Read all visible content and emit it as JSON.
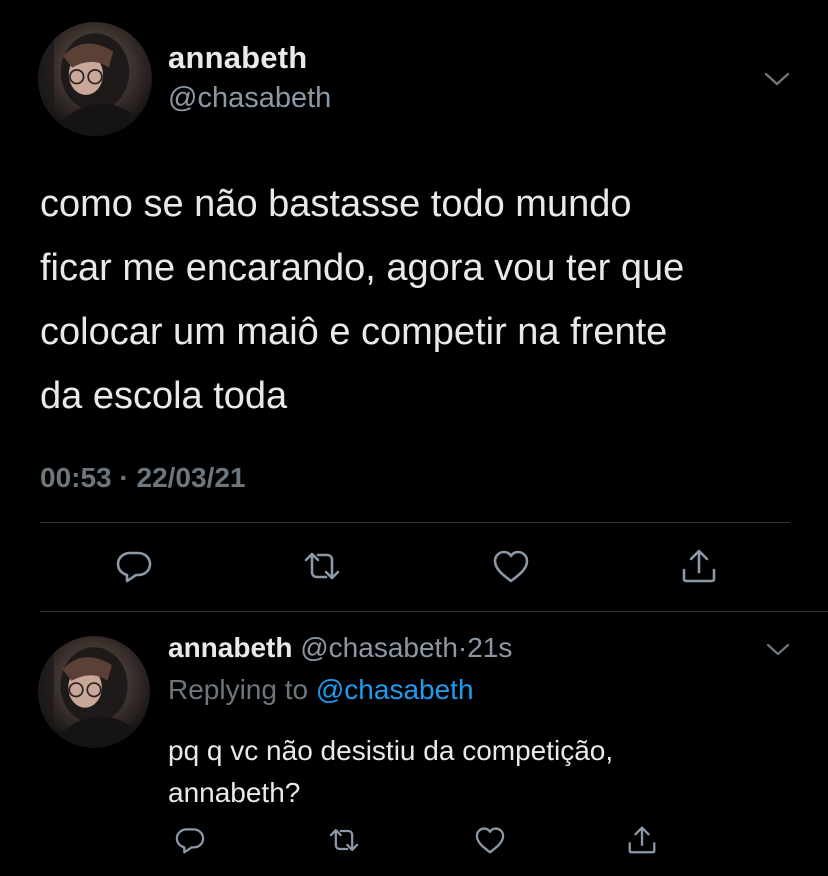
{
  "colors": {
    "background": "#000000",
    "text_primary": "#e7e9ea",
    "text_secondary": "#8b98a5",
    "text_meta": "#6e767d",
    "mention_blue": "#1d9bf0",
    "divider": "#2f3336"
  },
  "main_tweet": {
    "display_name": "annabeth",
    "handle": "@chasabeth",
    "text": "como se não bastasse todo mundo\nficar me encarando, agora vou ter que\ncolocar um maiô e competir na frente\nda escola toda",
    "meta": "00:53 · 22/03/21",
    "actions": [
      "reply-icon",
      "retweet-icon",
      "like-icon",
      "share-icon"
    ],
    "menu_icon": "chevron-down-icon"
  },
  "reply_tweet": {
    "display_name": "annabeth",
    "handle": "@chasabeth",
    "separator": "·",
    "time": "21s",
    "replying_prefix": "Replying to",
    "replying_mention": "@chasabeth",
    "text": "pq q vc não desistiu da competição,\nannabeth?",
    "actions": [
      "reply-icon",
      "retweet-icon",
      "like-icon",
      "share-icon"
    ],
    "menu_icon": "chevron-down-icon"
  }
}
